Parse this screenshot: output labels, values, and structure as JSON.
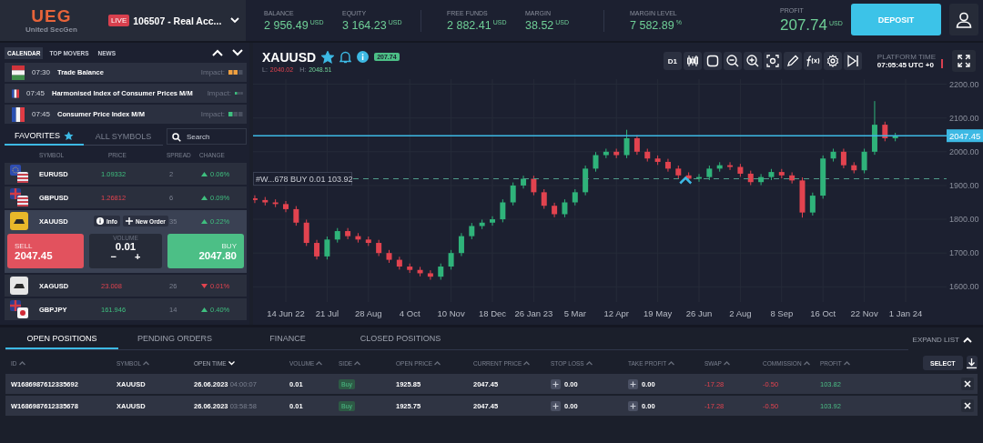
{
  "header": {
    "logo": {
      "mark": "UEG",
      "name": "United SecGen"
    },
    "account": {
      "badge": "LIVE",
      "label": "106507 - Real Acc..."
    },
    "stat_groups": [
      [
        {
          "label": "BALANCE",
          "value": "2 956.49",
          "unit": "USD"
        },
        {
          "label": "EQUITY",
          "value": "3 164.23",
          "unit": "USD"
        }
      ],
      [
        {
          "label": "FREE FUNDS",
          "value": "2 882.41",
          "unit": "USD"
        },
        {
          "label": "MARGIN",
          "value": "38.52",
          "unit": "USD"
        }
      ],
      [
        {
          "label": "MARGIN LEVEL",
          "value": "7 582.89",
          "unit": "%"
        }
      ]
    ],
    "profit": {
      "label": "PROFIT",
      "value": "207.74",
      "unit": "USD"
    },
    "deposit_button": "DEPOSIT"
  },
  "calendar": {
    "tabs": [
      {
        "label": "CALENDAR",
        "selected": true
      },
      {
        "label": "TOP MOVERS",
        "selected": false
      },
      {
        "label": "NEWS",
        "selected": false
      }
    ],
    "events": [
      {
        "time": "07:30",
        "title": "Trade Balance",
        "impact_label": "Impact:",
        "level": 0.67,
        "color": "#f0a040"
      },
      {
        "time": "07:45",
        "title": "Harmonised Index of Consumer Prices M/M",
        "impact_label": "Impact:",
        "level": 0.33,
        "color": "#3fbf7f"
      },
      {
        "time": "07:45",
        "title": "Consumer Price Index M/M",
        "impact_label": "Impact:",
        "level": 0.33,
        "color": "#3fbf7f"
      }
    ]
  },
  "symbols": {
    "tabs": [
      {
        "label": "FAVORITES",
        "selected": true,
        "star": true
      },
      {
        "label": "ALL SYMBOLS",
        "selected": false,
        "star": false
      }
    ],
    "search": {
      "placeholder": "Search"
    },
    "columns": [
      "SYMBOL",
      "PRICE",
      "SPREAD",
      "CHANGE"
    ],
    "rows": [
      {
        "symbol": "EURUSD",
        "price": "1.09332",
        "price_rising": true,
        "spread": "2",
        "change": "0.06%",
        "change_rising": true,
        "selected": false
      },
      {
        "symbol": "GBPUSD",
        "price": "1.26812",
        "price_rising": false,
        "spread": "6",
        "change": "0.09%",
        "change_rising": true,
        "selected": false
      },
      {
        "symbol": "XAUUSD",
        "actions": [
          "Info",
          "New Order"
        ],
        "spread": "35",
        "change": "0.22%",
        "change_rising": true,
        "selected": true,
        "trade": {
          "sell_label": "SELL",
          "sell_price": "2047.45",
          "volume_label": "VOLUME",
          "volume": "0.01",
          "decrement": "−",
          "increment": "+",
          "buy_label": "BUY",
          "buy_price": "2047.80"
        }
      },
      {
        "symbol": "XAGUSD",
        "price": "23.008",
        "price_rising": false,
        "spread": "26",
        "change": "0.01%",
        "change_rising": false,
        "selected": false
      },
      {
        "symbol": "GBPJPY",
        "price": "161.946",
        "price_rising": true,
        "spread": "14",
        "change": "0.40%",
        "change_rising": true,
        "selected": false
      }
    ]
  },
  "chart": {
    "symbol": "XAUUSD",
    "favorite": true,
    "badge": "207.74",
    "low_label": "L:",
    "low": "2040.02",
    "high_label": "H:",
    "high": "2048.51",
    "timeframe": "D1",
    "platform_time_label": "PLATFORM TIME",
    "platform_time": "07:05:45 UTC +0",
    "chart_data": {
      "type": "candlestick",
      "ylim": [
        1555,
        2215
      ],
      "categories": [
        null,
        null,
        null,
        "14 Jun 22",
        null,
        null,
        null,
        "21 Jul",
        null,
        null,
        null,
        "28 Aug",
        null,
        null,
        null,
        "4 Oct",
        null,
        null,
        null,
        "10 Nov",
        null,
        null,
        null,
        "18 Dec",
        null,
        null,
        null,
        "26 Jan 23",
        null,
        null,
        null,
        "5 Mar",
        null,
        null,
        null,
        "12 Apr",
        null,
        null,
        null,
        "19 May",
        null,
        null,
        null,
        "26 Jun",
        null,
        null,
        null,
        "2 Aug",
        null,
        null,
        null,
        "8 Sep",
        null,
        null,
        null,
        "16 Oct",
        null,
        null,
        null,
        "22 Nov",
        null,
        null,
        null,
        "1 Jan 24"
      ],
      "yticks": [
        {
          "value": 1600,
          "label": "1600.00"
        },
        {
          "value": 1700,
          "label": "1700.00"
        },
        {
          "value": 1800,
          "label": "1800.00"
        },
        {
          "value": 1900,
          "label": "1900.00"
        },
        {
          "value": 2000,
          "label": "2000.00"
        },
        {
          "value": 2100,
          "label": "2100.00"
        },
        {
          "value": 2200,
          "label": "2200.00"
        }
      ],
      "ohlc": [
        [
          1862,
          1871,
          1848,
          1857
        ],
        [
          1857,
          1866,
          1841,
          1850
        ],
        [
          1850,
          1859,
          1836,
          1845
        ],
        [
          1845,
          1854,
          1821,
          1830
        ],
        [
          1830,
          1839,
          1781,
          1790
        ],
        [
          1790,
          1799,
          1721,
          1730
        ],
        [
          1730,
          1739,
          1681,
          1690
        ],
        [
          1690,
          1749,
          1681,
          1740
        ],
        [
          1740,
          1774,
          1731,
          1765
        ],
        [
          1765,
          1774,
          1741,
          1750
        ],
        [
          1750,
          1759,
          1731,
          1740
        ],
        [
          1740,
          1749,
          1721,
          1730
        ],
        [
          1730,
          1739,
          1691,
          1700
        ],
        [
          1700,
          1709,
          1671,
          1680
        ],
        [
          1680,
          1689,
          1651,
          1660
        ],
        [
          1660,
          1669,
          1641,
          1650
        ],
        [
          1650,
          1659,
          1631,
          1640
        ],
        [
          1640,
          1649,
          1621,
          1630
        ],
        [
          1630,
          1669,
          1621,
          1660
        ],
        [
          1660,
          1709,
          1651,
          1700
        ],
        [
          1700,
          1759,
          1691,
          1750
        ],
        [
          1750,
          1789,
          1741,
          1780
        ],
        [
          1780,
          1799,
          1771,
          1790
        ],
        [
          1790,
          1809,
          1781,
          1800
        ],
        [
          1800,
          1859,
          1791,
          1850
        ],
        [
          1850,
          1909,
          1841,
          1900
        ],
        [
          1900,
          1929,
          1891,
          1920
        ],
        [
          1920,
          1929,
          1871,
          1880
        ],
        [
          1880,
          1889,
          1831,
          1840
        ],
        [
          1840,
          1849,
          1806,
          1815
        ],
        [
          1815,
          1859,
          1806,
          1850
        ],
        [
          1850,
          1889,
          1841,
          1880
        ],
        [
          1880,
          1959,
          1871,
          1950
        ],
        [
          1950,
          1999,
          1941,
          1990
        ],
        [
          1990,
          2009,
          1981,
          2000
        ],
        [
          2000,
          2009,
          1981,
          1990
        ],
        [
          1990,
          2065,
          1981,
          2040
        ],
        [
          2040,
          2049,
          1991,
          2000
        ],
        [
          2000,
          2009,
          1971,
          1980
        ],
        [
          1980,
          1989,
          1961,
          1970
        ],
        [
          1970,
          1979,
          1941,
          1950
        ],
        [
          1950,
          1959,
          1921,
          1930
        ],
        [
          1930,
          1939,
          1911,
          1920
        ],
        [
          1920,
          1934,
          1911,
          1925
        ],
        [
          1925,
          1959,
          1916,
          1950
        ],
        [
          1950,
          1969,
          1941,
          1960
        ],
        [
          1960,
          1969,
          1946,
          1955
        ],
        [
          1955,
          1964,
          1926,
          1935
        ],
        [
          1935,
          1944,
          1901,
          1910
        ],
        [
          1910,
          1934,
          1901,
          1925
        ],
        [
          1925,
          1949,
          1916,
          1940
        ],
        [
          1940,
          1949,
          1921,
          1930
        ],
        [
          1930,
          1939,
          1906,
          1915
        ],
        [
          1915,
          1924,
          1805,
          1820
        ],
        [
          1820,
          1879,
          1811,
          1870
        ],
        [
          1870,
          1989,
          1861,
          1980
        ],
        [
          1980,
          2009,
          1971,
          2000
        ],
        [
          2000,
          2009,
          1951,
          1960
        ],
        [
          1960,
          1969,
          1936,
          1945
        ],
        [
          1945,
          2009,
          1936,
          2000
        ],
        [
          2000,
          2150,
          1991,
          2080
        ],
        [
          2080,
          2089,
          2031,
          2040
        ],
        [
          2040,
          2056,
          2031,
          2047
        ],
        null
      ],
      "grid": true,
      "ref_lines": [
        {
          "axis": "y",
          "value": 2047.45,
          "label": "2047.45"
        },
        {
          "axis": "y",
          "value": 1920,
          "label": "#W...678  BUY 0.01  103.92"
        }
      ]
    }
  },
  "positions": {
    "tabs": [
      {
        "label": "OPEN POSITIONS",
        "selected": true
      },
      {
        "label": "PENDING ORDERS",
        "selected": false
      },
      {
        "label": "FINANCE",
        "selected": false
      },
      {
        "label": "CLOSED POSITIONS",
        "selected": false
      }
    ],
    "expand_label": "EXPAND LIST",
    "columns": [
      {
        "label": "ID",
        "active": false
      },
      {
        "label": "SYMBOL",
        "active": false
      },
      {
        "label": "OPEN TIME",
        "active": true
      },
      {
        "label": "VOLUME",
        "active": false
      },
      {
        "label": "SIDE",
        "active": false
      },
      {
        "label": "OPEN PRICE",
        "active": false
      },
      {
        "label": "CURRENT PRICE",
        "active": false
      },
      {
        "label": "STOP LOSS",
        "active": false
      },
      {
        "label": "TAKE PROFIT",
        "active": false
      },
      {
        "label": "SWAP",
        "active": false
      },
      {
        "label": "COMMISSION",
        "active": false
      },
      {
        "label": "PROFIT",
        "active": false
      }
    ],
    "select_button": "SELECT",
    "rows": [
      {
        "id": "W1686987612335692",
        "symbol": "XAUUSD",
        "open_date": "26.06.2023",
        "open_time": "04:00:07",
        "volume": "0.01",
        "side": "Buy",
        "open_price": "1925.85",
        "current_price": "2047.45",
        "stop_loss": "0.00",
        "take_profit": "0.00",
        "swap": "-17.28",
        "commission": "-0.50",
        "profit": "103.82"
      },
      {
        "id": "W1686987612335678",
        "symbol": "XAUUSD",
        "open_date": "26.06.2023",
        "open_time": "03:58:58",
        "volume": "0.01",
        "side": "Buy",
        "open_price": "1925.75",
        "current_price": "2047.45",
        "stop_loss": "0.00",
        "take_profit": "0.00",
        "swap": "-17.28",
        "commission": "-0.50",
        "profit": "103.92"
      }
    ]
  }
}
